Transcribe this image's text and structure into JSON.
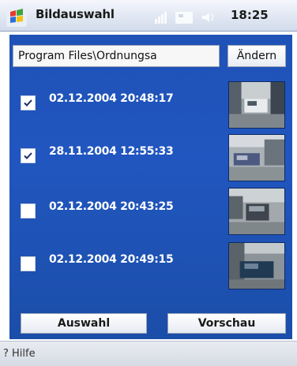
{
  "title_bar": {
    "app_title": "Bildauswahl",
    "clock": "18:25",
    "start_icon": "windows-flag-icon",
    "tray_icons": [
      "signal-icon",
      "connectivity-icon",
      "speaker-icon"
    ]
  },
  "path": {
    "value": "Program Files\\Ordnungsa",
    "change_label": "Ändern"
  },
  "images": [
    {
      "timestamp": "02.12.2004 20:48:17",
      "checked": true
    },
    {
      "timestamp": "28.11.2004 12:55:33",
      "checked": true
    },
    {
      "timestamp": "02.12.2004 20:43:25",
      "checked": false
    },
    {
      "timestamp": "02.12.2004 20:49:15",
      "checked": false
    }
  ],
  "buttons": {
    "select_label": "Auswahl",
    "preview_label": "Vorschau"
  },
  "footer": {
    "help_label": "? Hilfe"
  },
  "colors": {
    "background_blue": "#2156c0",
    "text_white": "#ffffff"
  }
}
